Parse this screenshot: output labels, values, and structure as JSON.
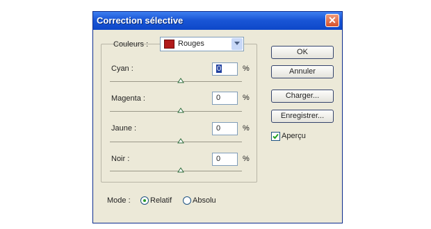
{
  "window": {
    "title": "Correction sélective",
    "close_symbol": "✕"
  },
  "colors": {
    "label": "Couleurs :",
    "selected": "Rouges",
    "swatch": "#b11a1a"
  },
  "channels": [
    {
      "label": "Cyan :",
      "value": "0",
      "unit": "%",
      "level_percent": 0
    },
    {
      "label": "Magenta :",
      "value": "0",
      "unit": "%",
      "level_percent": 0
    },
    {
      "label": "Jaune :",
      "value": "0",
      "unit": "%",
      "level_percent": 0
    },
    {
      "label": "Noir :",
      "value": "0",
      "unit": "%",
      "level_percent": 0
    }
  ],
  "buttons": {
    "ok": "OK",
    "cancel": "Annuler",
    "load": "Charger...",
    "save": "Enregistrer..."
  },
  "preview": {
    "label": "Aperçu",
    "checked": true
  },
  "mode": {
    "label": "Mode :",
    "options": [
      "Relatif",
      "Absolu"
    ],
    "selected": "Relatif"
  }
}
